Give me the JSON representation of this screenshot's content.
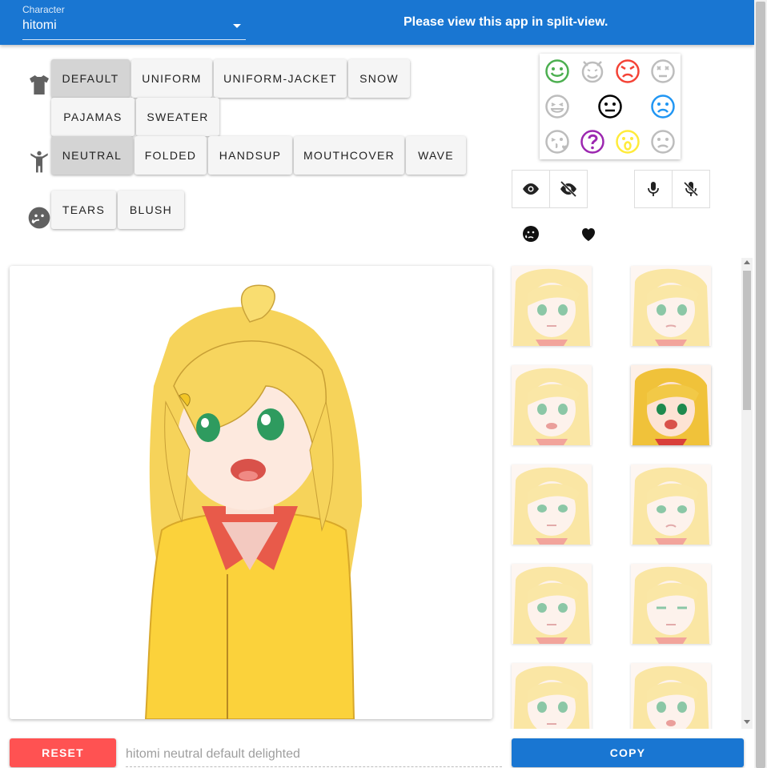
{
  "header": {
    "character_label": "Character",
    "character_value": "hitomi",
    "notice": "Please view this app in split-view."
  },
  "outfit": {
    "icon": "shirt-icon",
    "options": [
      "DEFAULT",
      "UNIFORM",
      "UNIFORM-JACKET",
      "SNOW",
      "PAJAMAS",
      "SWEATER"
    ],
    "selected": "DEFAULT"
  },
  "pose": {
    "icon": "person-icon",
    "options": [
      "NEUTRAL",
      "FOLDED",
      "HANDSUP",
      "MOUTHCOVER",
      "WAVE"
    ],
    "selected": "NEUTRAL"
  },
  "effects": {
    "icon": "tears-face-icon",
    "options": [
      "TEARS",
      "BLUSH"
    ]
  },
  "emotions": [
    {
      "icon": "smile-icon",
      "color": "#4caf50"
    },
    {
      "icon": "devil-icon",
      "color": "#bdbdbd"
    },
    {
      "icon": "angry-icon",
      "color": "#f44336"
    },
    {
      "icon": "dizzy-icon",
      "color": "#bdbdbd"
    },
    {
      "icon": "tongue-icon",
      "color": "#bdbdbd"
    },
    {
      "icon": "neutral-icon",
      "color": "#000000"
    },
    {
      "icon": "sad-icon",
      "color": "#2196f3"
    },
    {
      "icon": "kiss-icon",
      "color": "#bdbdbd"
    },
    {
      "icon": "question-icon",
      "color": "#9c27b0"
    },
    {
      "icon": "surprised-icon",
      "color": "#ffeb3b"
    },
    {
      "icon": "frown-icon",
      "color": "#bdbdbd"
    }
  ],
  "toggles": {
    "eye": "eye-icon",
    "eye_off": "eye-off-icon",
    "mic": "mic-icon",
    "mic_off": "mic-off-icon",
    "tears_filter": "tears-face-icon",
    "heart": "heart-icon"
  },
  "bottom": {
    "reset_label": "RESET",
    "name_value": "hitomi neutral default delighted",
    "copy_label": "COPY"
  },
  "colors": {
    "primary": "#1976d2",
    "reset": "#ff5252"
  }
}
